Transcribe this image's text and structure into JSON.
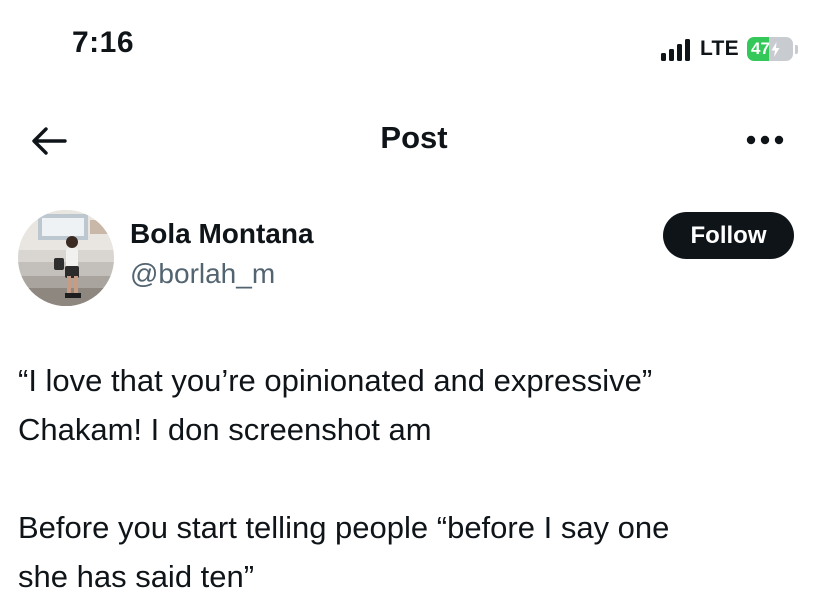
{
  "status_bar": {
    "time": "7:16",
    "network": "LTE",
    "battery_text": "47",
    "battery_level": 0.47,
    "battery_color": "#34c759",
    "charging": true
  },
  "header": {
    "title": "Post",
    "back_icon": "arrow-left-icon",
    "more_icon": "more-horizontal-icon"
  },
  "author": {
    "name": "Bola Montana",
    "handle": "@borlah_m",
    "follow_label": "Follow"
  },
  "post": {
    "paragraphs": [
      [
        "“I love that you’re opinionated and expressive”",
        "Chakam! I don screenshot am"
      ],
      [
        "Before you start telling people “before I say one",
        "she has said ten”"
      ]
    ]
  },
  "colors": {
    "text": "#0f1419",
    "secondary_text": "#536471",
    "follow_bg": "#0f1419",
    "follow_text": "#ffffff"
  }
}
